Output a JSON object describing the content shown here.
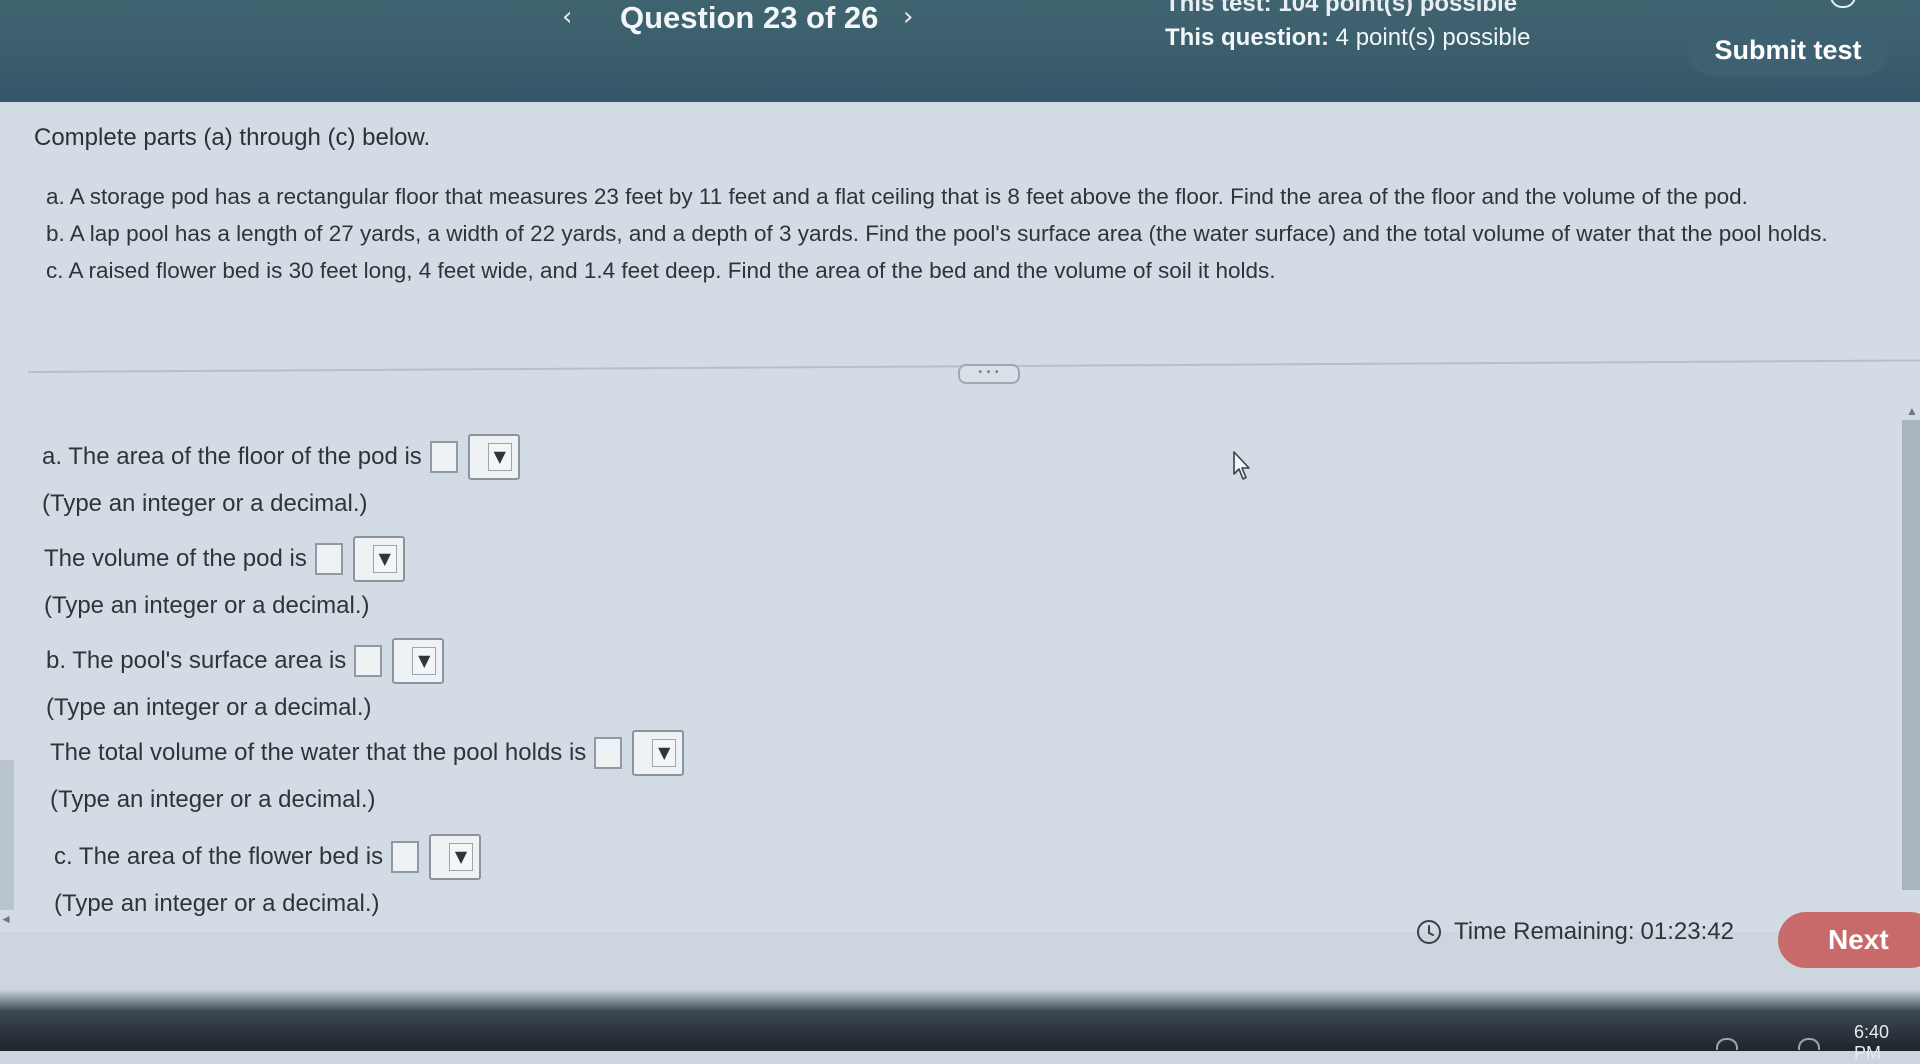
{
  "header": {
    "prev_glyph": "‹",
    "next_glyph": "›",
    "question_title": "Question 23 of 26",
    "test_points": "This test: 104 point(s) possible",
    "question_points_label": "This question:",
    "question_points_value": "4 point(s) possible",
    "submit_label": "Submit test"
  },
  "problem": {
    "intro": "Complete parts (a) through (c) below.",
    "part_a": "a. A storage pod has a rectangular floor that measures 23 feet by 11 feet and a flat ceiling that is 8 feet above the floor. Find the area of the floor and the volume of the pod.",
    "part_b": "b. A lap pool has a length of 27 yards, a width of 22 yards, and a depth of 3 yards. Find the pool's surface area (the water surface) and the total volume of water that the pool holds.",
    "part_c": "c. A raised flower bed is 30 feet long, 4 feet wide, and 1.4 feet deep. Find the area of the bed and the volume of soil it holds."
  },
  "expand_label": "• • •",
  "answers": [
    {
      "prompt": "a. The area of the floor of the pod is",
      "hint": "(Type an integer or a decimal.)"
    },
    {
      "prompt": "The volume of the pod is",
      "hint": "(Type an integer or a decimal.)"
    },
    {
      "prompt": "b. The pool's surface area is",
      "hint": "(Type an integer or a decimal.)"
    },
    {
      "prompt": "The total volume of the water that the pool holds is",
      "hint": "(Type an integer or a decimal.)"
    },
    {
      "prompt": "c. The area of the flower bed is",
      "hint": "(Type an integer or a decimal.)"
    }
  ],
  "dropdown_caret": "▼",
  "footer": {
    "time_label": "Time Remaining:",
    "time_value": "01:23:42",
    "next_label": "Next"
  },
  "taskbar": {
    "clock": "6:40 PM"
  },
  "colors": {
    "header_bg": "#3a5d6b",
    "panel_bg": "#d3dce4",
    "next_button": "#c86a6a"
  }
}
